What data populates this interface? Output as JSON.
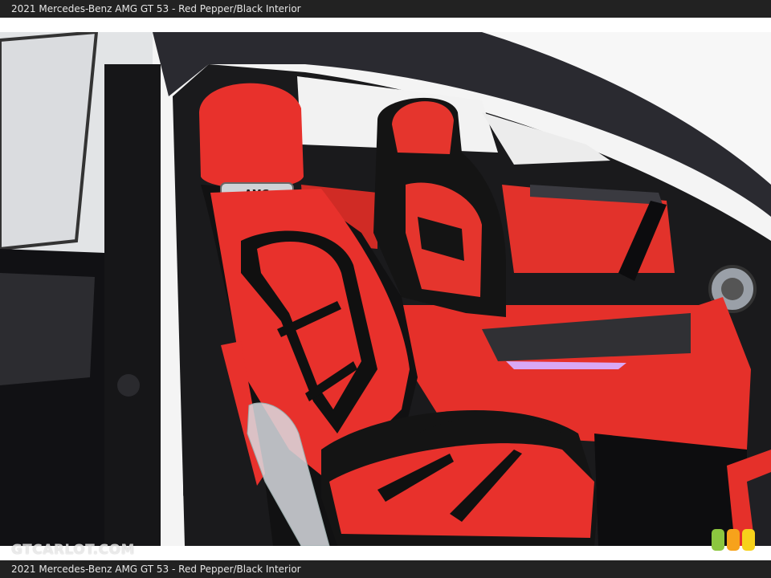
{
  "caption": {
    "top": "2021 Mercedes-Benz AMG GT 53 - Red Pepper/Black Interior",
    "bottom": "2021 Mercedes-Benz AMG GT 53 - Red Pepper/Black Interior"
  },
  "photo": {
    "subject": "Front passenger seat and dashboard through open door",
    "seat_badge": "AMG",
    "colors": {
      "red_leather": "#e8312c",
      "black_trim": "#141414",
      "car_body": "#1e1e22",
      "window": "#f2f2f2"
    }
  },
  "watermark": {
    "text": "GTCARLOT.COM"
  },
  "badge_colors": [
    "#8cc63f",
    "#f7a21b",
    "#f7d21b"
  ]
}
